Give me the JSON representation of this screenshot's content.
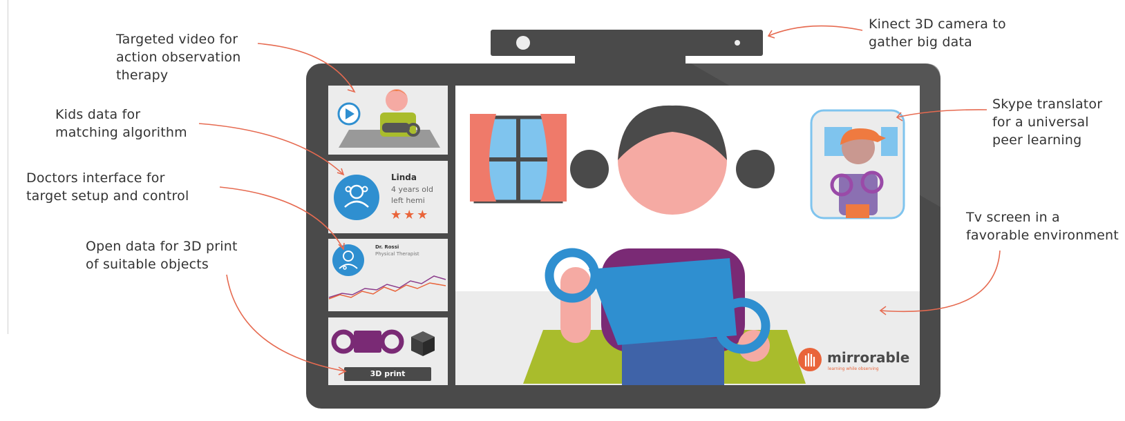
{
  "annotations": {
    "video": "Targeted video for\naction observation\ntherapy",
    "kids": "Kids data for\nmatching algorithm",
    "doctors": "Doctors interface for\ntarget setup and control",
    "print": "Open data for 3D print\nof suitable objects",
    "kinect": "Kinect 3D camera to\ngather big data",
    "skype": "Skype translator\nfor a universal\npeer learning",
    "tv": "Tv screen in a\nfavorable environment"
  },
  "kid_card": {
    "name": "Linda",
    "age": "4 years old",
    "condition": "left hemi",
    "stars": 3
  },
  "doctor_card": {
    "name": "Dr. Rossi",
    "role": "Physical Therapist"
  },
  "print_button": {
    "label": "3D print"
  },
  "brand": {
    "name": "mirrorable",
    "tagline": "learning while observing"
  },
  "colors": {
    "frame": "#4a4a4a",
    "annotation_arrow": "#e66a50",
    "accent_blue": "#2f8fd0",
    "purple": "#7a2a75",
    "star": "#e9643a",
    "mat": "#a9bc2c",
    "curtain": "#ef7a6a",
    "skin": "#f5aaa3"
  },
  "icons": [
    "play-icon",
    "kid-avatar-icon",
    "doctor-avatar-icon",
    "cube-icon",
    "hand-logo-icon"
  ]
}
